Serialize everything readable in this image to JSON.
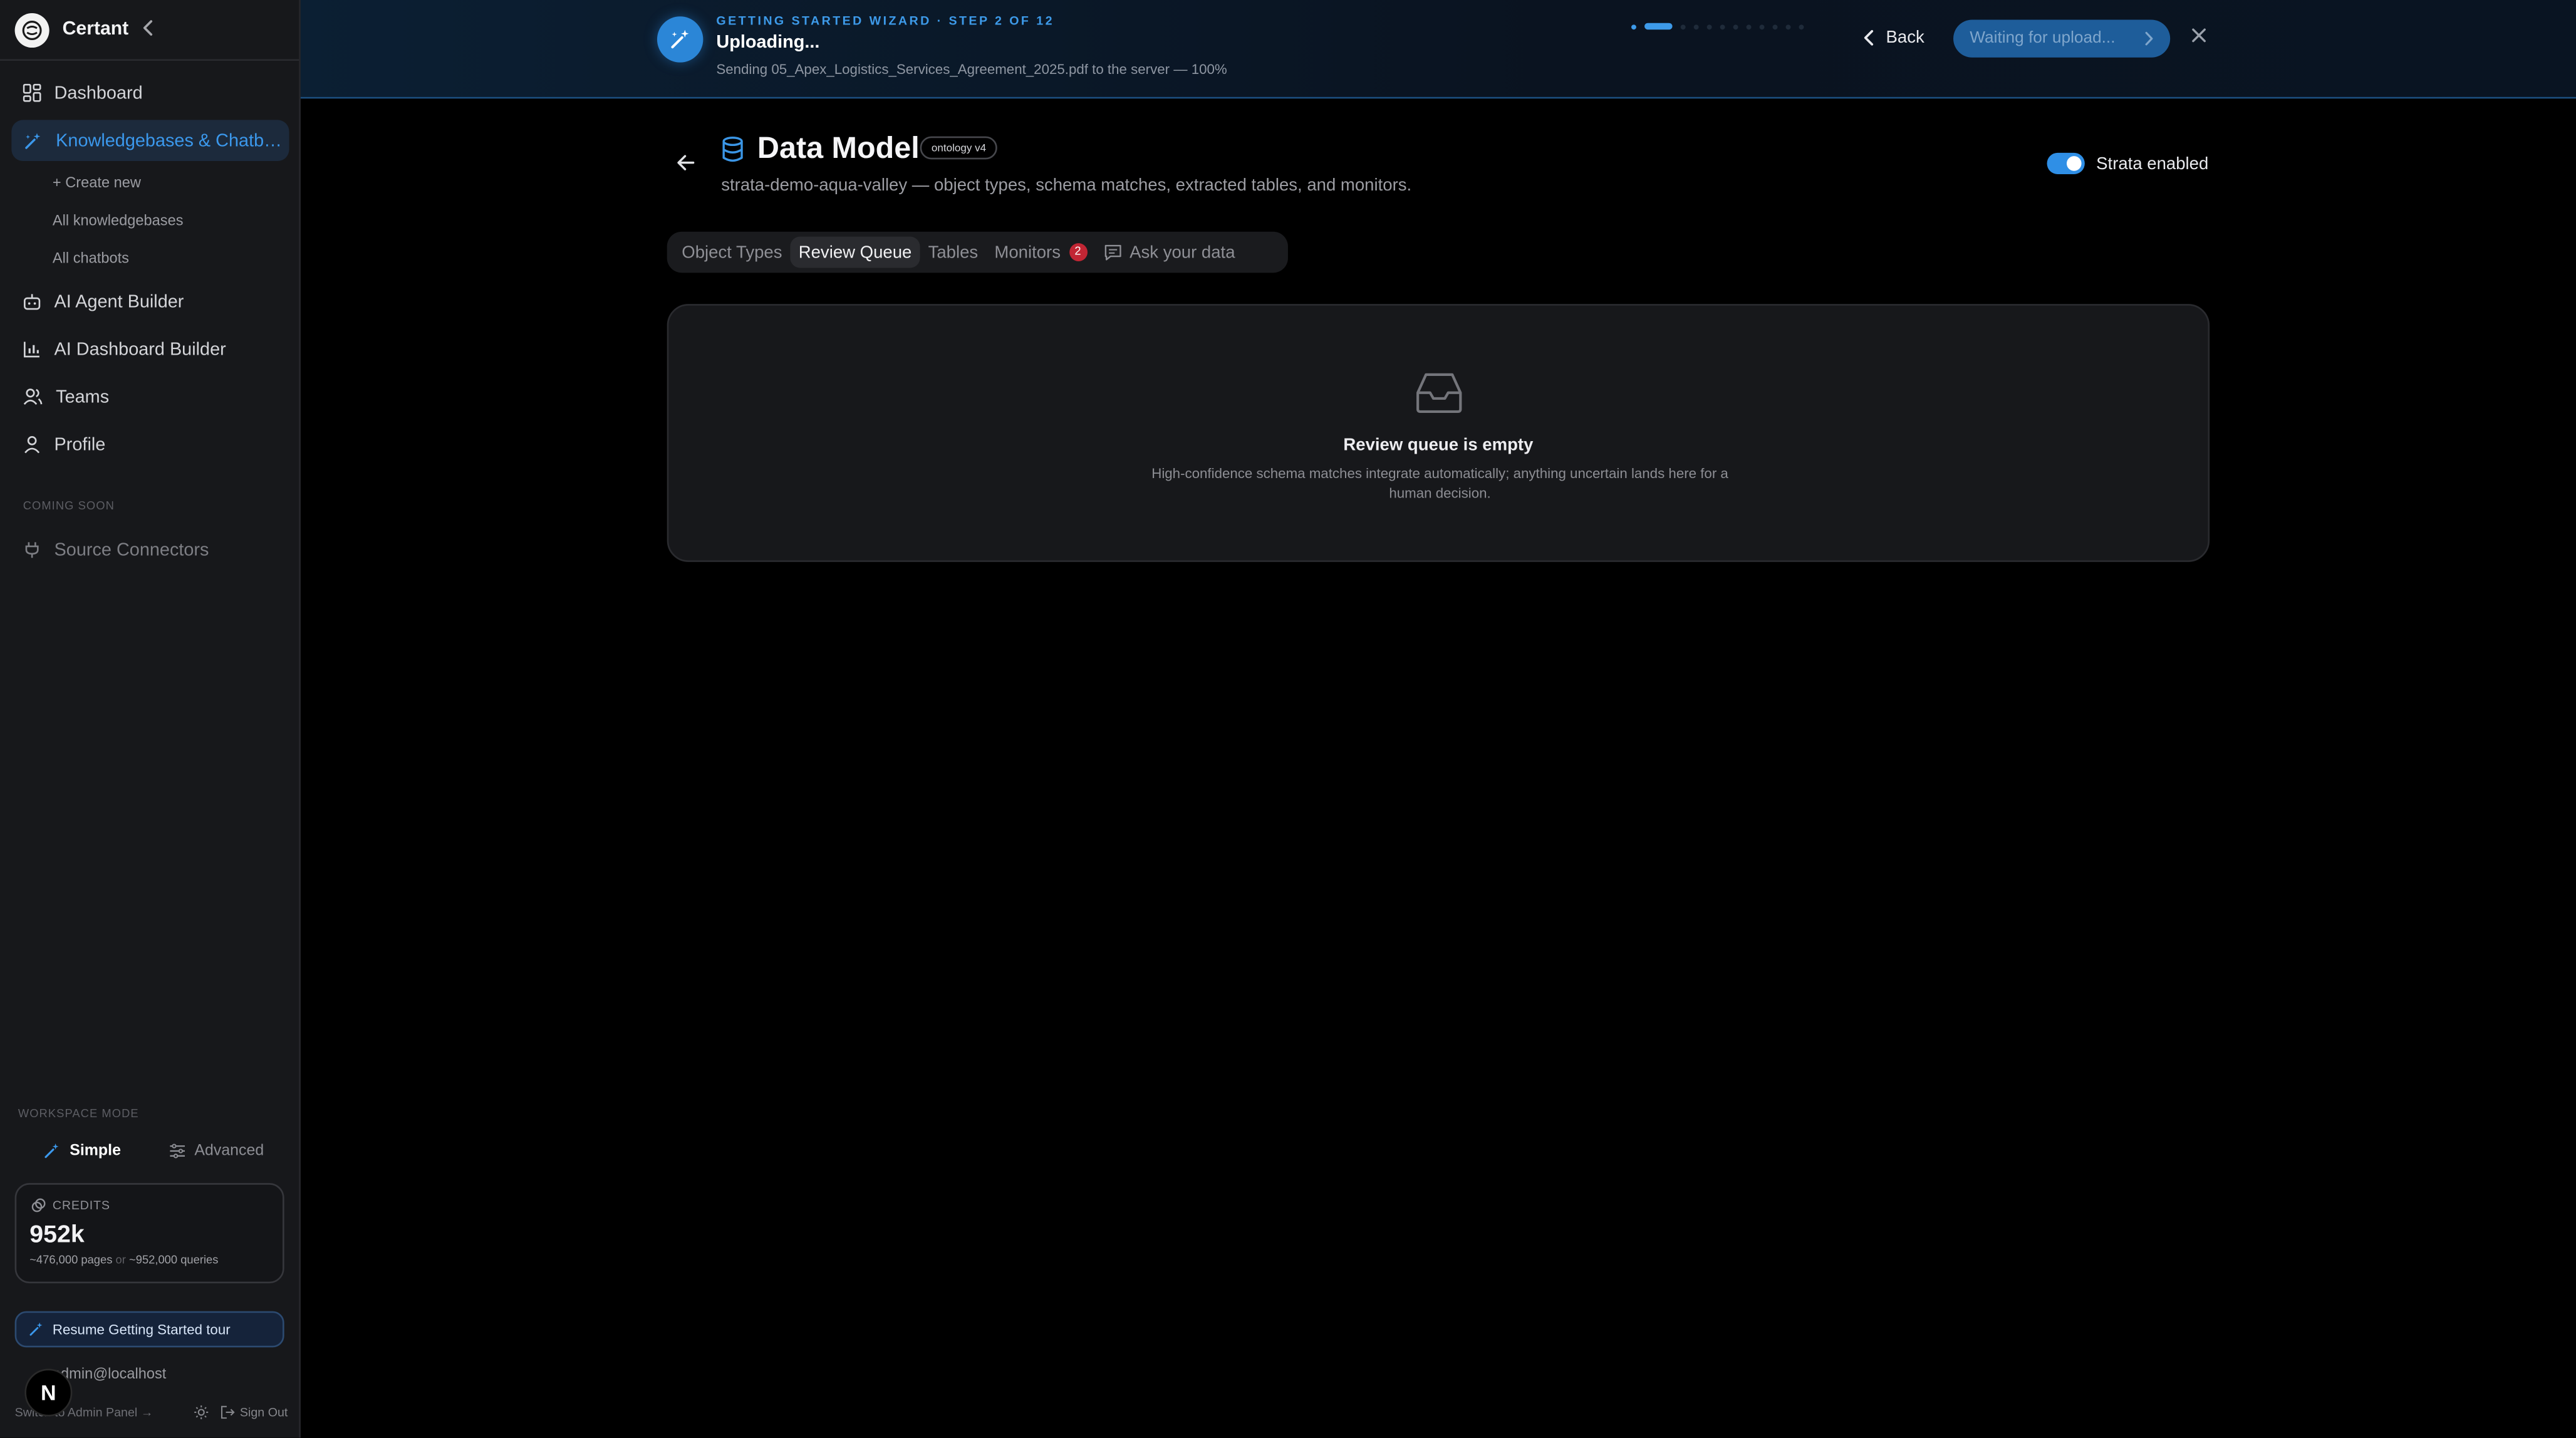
{
  "sidebar": {
    "brand": "Certant",
    "nav": [
      {
        "label": "Dashboard",
        "icon": "dashboard-icon"
      },
      {
        "label": "Knowledgebases & Chatbots",
        "icon": "sparkles-icon"
      },
      {
        "label": "AI Agent Builder",
        "icon": "bot-icon"
      },
      {
        "label": "AI Dashboard Builder",
        "icon": "bar-chart-icon"
      },
      {
        "label": "Teams",
        "icon": "users-icon"
      },
      {
        "label": "Profile",
        "icon": "user-icon"
      }
    ],
    "sub_items": [
      "+ Create new",
      "All knowledgebases",
      "All chatbots"
    ],
    "coming_soon_label": "COMING SOON",
    "source_connectors": "Source Connectors",
    "workspace_mode_label": "WORKSPACE MODE",
    "mode_simple": "Simple",
    "mode_advanced": "Advanced",
    "credits_label": "CREDITS",
    "credits_value": "952k",
    "credits_pages": "~476,000 pages",
    "credits_or": "or",
    "credits_queries": "~952,000 queries",
    "resume_tour": "Resume Getting Started tour",
    "email": "admin@localhost",
    "admin_link": "Switch to Admin Panel →",
    "sign_out": "Sign Out",
    "n_badge": "N"
  },
  "wizard": {
    "step": "GETTING STARTED WIZARD · STEP 2 OF 12",
    "title": "Uploading...",
    "description": "Sending 05_Apex_Logistics_Services_Agreement_2025.pdf to the server — 100%",
    "current_step": 2,
    "total_steps": 12,
    "back_label": "Back",
    "next_label": "Waiting for upload...",
    "accent": "#3d9ae9"
  },
  "main": {
    "title": "Data Model",
    "badge": "ontology v4",
    "subtitle": "strata-demo-aqua-valley — object types, schema matches, extracted tables, and monitors.",
    "strata_label": "Strata enabled",
    "strata_enabled": true,
    "tabs": [
      {
        "label": "Object Types"
      },
      {
        "label": "Review Queue",
        "active": true
      },
      {
        "label": "Tables"
      },
      {
        "label": "Monitors",
        "count": "2"
      },
      {
        "label": "Ask your data"
      }
    ],
    "empty_title": "Review queue is empty",
    "empty_desc": "High-confidence schema matches integrate automatically; anything uncertain lands here for a human decision."
  }
}
